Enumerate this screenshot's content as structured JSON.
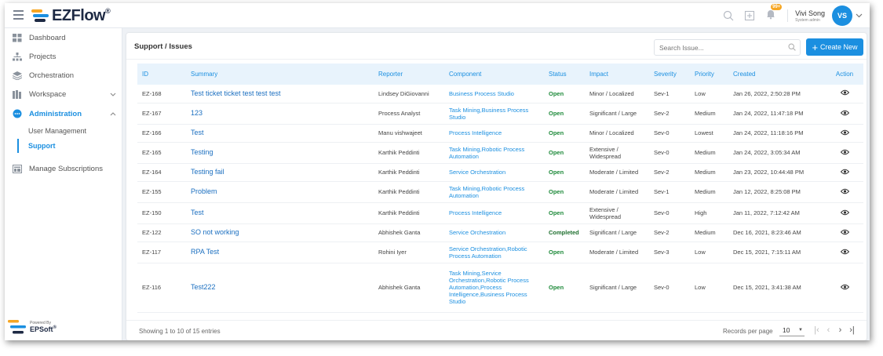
{
  "brand": {
    "name": "EZFlow",
    "mark": "®",
    "colors": {
      "accent": "#1b8fe0",
      "orange": "#f6a623",
      "dark": "#1e2a44",
      "status_green": "#1e8a3a"
    }
  },
  "topbar": {
    "notification_count": "99+",
    "user_name": "Vivi Song",
    "user_role": "System admin",
    "avatar_initials": "VS"
  },
  "sidebar": {
    "items": [
      {
        "label": "Dashboard",
        "icon": "grid-icon"
      },
      {
        "label": "Projects",
        "icon": "hierarchy-icon"
      },
      {
        "label": "Orchestration",
        "icon": "layers-icon"
      },
      {
        "label": "Workspace",
        "icon": "books-icon"
      },
      {
        "label": "Administration",
        "icon": "dots-circle-icon"
      },
      {
        "label": "Manage Subscriptions",
        "icon": "subscriptions-icon"
      }
    ],
    "subitems": [
      {
        "label": "User Management"
      },
      {
        "label": "Support"
      }
    ],
    "powered_by": "Powered By",
    "powered_brand": "EPSoft",
    "powered_mark": "®"
  },
  "card": {
    "title": "Support / Issues",
    "search_placeholder": "Search Issue...",
    "create_label": "Create New"
  },
  "table": {
    "columns": [
      "ID",
      "Summary",
      "Reporter",
      "Component",
      "Status",
      "Impact",
      "Severity",
      "Priority",
      "Created",
      "Action"
    ],
    "rows": [
      {
        "id": "EZ-168",
        "summary": "Test ticket ticket test test test",
        "reporter": "Lindsey DiGiovanni",
        "component": "Business Process Studio",
        "status": "Open",
        "impact": "Minor / Localized",
        "severity": "Sev-1",
        "priority": "Low",
        "created": "Jan 26, 2022, 2:50:28 PM"
      },
      {
        "id": "EZ-167",
        "summary": "123",
        "reporter": "Process Analyst",
        "component": "Task Mining,Business Process Studio",
        "status": "Open",
        "impact": "Significant / Large",
        "severity": "Sev-2",
        "priority": "Medium",
        "created": "Jan 24, 2022, 11:47:18 PM"
      },
      {
        "id": "EZ-166",
        "summary": "Test",
        "reporter": "Manu vishwajeet",
        "component": "Process Intelligence",
        "status": "Open",
        "impact": "Minor / Localized",
        "severity": "Sev-0",
        "priority": "Lowest",
        "created": "Jan 24, 2022, 11:18:16 PM"
      },
      {
        "id": "EZ-165",
        "summary": "Testing",
        "reporter": "Karthik Peddinti",
        "component": "Task Mining,Robotic Process Automation",
        "status": "Open",
        "impact": "Extensive / Widespread",
        "severity": "Sev-0",
        "priority": "Medium",
        "created": "Jan 24, 2022, 3:05:34 AM"
      },
      {
        "id": "EZ-164",
        "summary": "Testing fail",
        "reporter": "Karthik Peddinti",
        "component": "Service Orchestration",
        "status": "Open",
        "impact": "Moderate / Limited",
        "severity": "Sev-2",
        "priority": "Medium",
        "created": "Jan 23, 2022, 10:44:48 PM"
      },
      {
        "id": "EZ-155",
        "summary": "Problem",
        "reporter": "Karthik Peddinti",
        "component": "Task Mining,Robotic Process Automation",
        "status": "Open",
        "impact": "Moderate / Limited",
        "severity": "Sev-1",
        "priority": "Medium",
        "created": "Jan 12, 2022, 8:25:08 PM"
      },
      {
        "id": "EZ-150",
        "summary": "Test",
        "reporter": "Karthik Peddinti",
        "component": "Process Intelligence",
        "status": "Open",
        "impact": "Extensive / Widespread",
        "severity": "Sev-0",
        "priority": "High",
        "created": "Jan 11, 2022, 7:12:42 AM"
      },
      {
        "id": "EZ-122",
        "summary": "SO not working",
        "reporter": "Abhishek Ganta",
        "component": "Service Orchestration",
        "status": "Completed",
        "impact": "Significant / Large",
        "severity": "Sev-2",
        "priority": "Medium",
        "created": "Dec 16, 2021, 8:23:46 AM"
      },
      {
        "id": "EZ-117",
        "summary": "RPA Test",
        "reporter": "Rohini Iyer",
        "component": "Service Orchestration,Robotic Process Automation",
        "status": "Open",
        "impact": "Moderate / Limited",
        "severity": "Sev-3",
        "priority": "Low",
        "created": "Dec 15, 2021, 7:15:11 AM"
      },
      {
        "id": "EZ-116",
        "summary": "Test222",
        "reporter": "Abhishek Ganta",
        "component": "Task Mining,Service Orchestration,Robotic Process Automation,Process Intelligence,Business Process Studio",
        "status": "Open",
        "impact": "Significant / Large",
        "severity": "Sev-0",
        "priority": "Low",
        "created": "Dec 15, 2021, 3:41:38 AM"
      }
    ]
  },
  "footer": {
    "entries_text": "Showing 1 to 10 of 15 entries",
    "records_label": "Records per page",
    "records_value": "10"
  }
}
